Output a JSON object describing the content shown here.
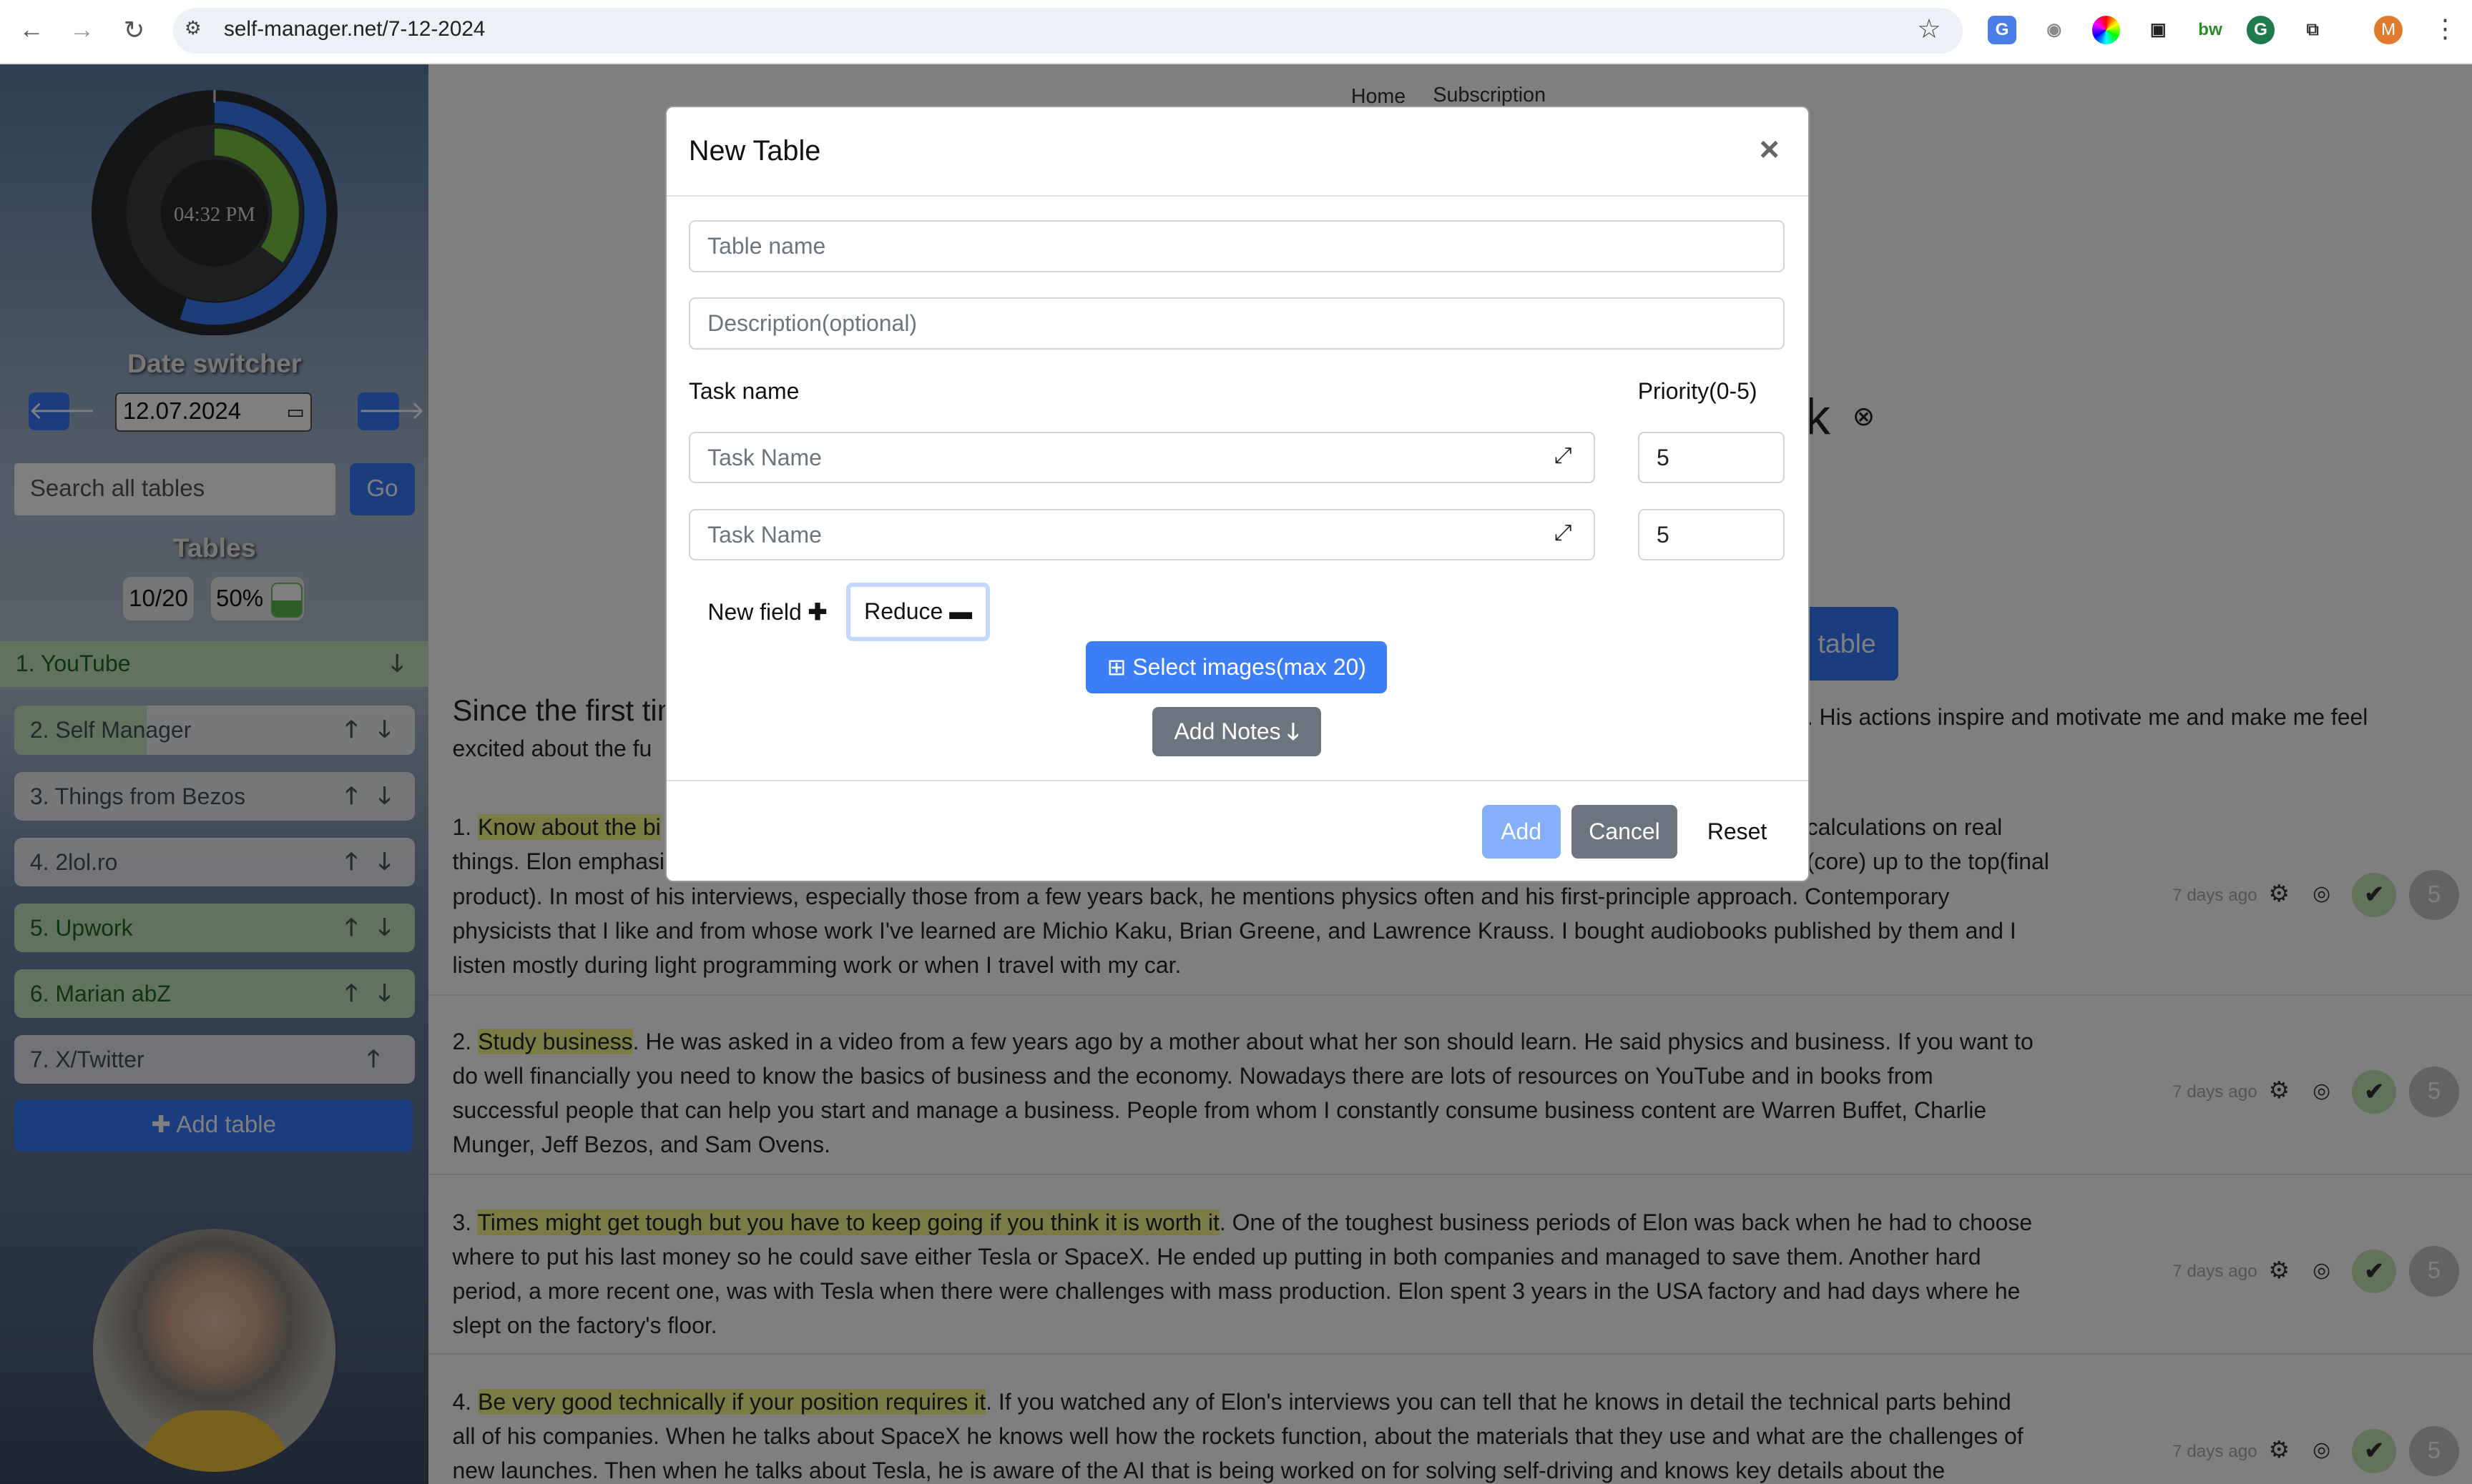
{
  "browser": {
    "url": "self-manager.net/7-12-2024",
    "profile_initial": "M",
    "ext_icons": [
      "translate-icon",
      "camera-icon",
      "color-wheel-icon",
      "extension-icon",
      "bw-icon",
      "grammarly-icon",
      "puzzle-icon"
    ]
  },
  "sidebar": {
    "clock": {
      "time": "04:32 PM",
      "outer_fill": 0.55,
      "inner_fill": 0.35,
      "outer_color": "#3a7bf5",
      "inner_color": "#76c442"
    },
    "date_switcher_label": "Date switcher",
    "date_value": "12.07.2024",
    "search_placeholder": "Search all tables",
    "go_label": "Go",
    "tables_label": "Tables",
    "count_badge": "10/20",
    "percent_badge": "50%",
    "percent_fill": 0.5,
    "tables": [
      {
        "label": "1. YouTube",
        "status": "done"
      },
      {
        "label": "2. Self Manager",
        "status": "partial",
        "progress": 0.33
      },
      {
        "label": "3. Things from Bezos",
        "status": "none"
      },
      {
        "label": "4. 2lol.ro",
        "status": "none"
      },
      {
        "label": "5. Upwork",
        "status": "done"
      },
      {
        "label": "6. Marian abZ",
        "status": "done"
      },
      {
        "label": "7. X/Twitter",
        "status": "none"
      }
    ],
    "add_table_label": "Add table"
  },
  "main": {
    "nav": [
      "Home",
      "Subscription"
    ],
    "title_fragment": "k",
    "table_button_fragment": "table",
    "intro_left": [
      "Since the first time",
      "excited about the fu"
    ],
    "intro_right": ". His actions inspire and motivate me and make me feel",
    "item1": {
      "prefix": "1. ",
      "highlight": "Know about the bi",
      "right_fragments": [
        "calculations on real",
        "(core) up to the top(final"
      ],
      "left_fragment2": "things. Elon emphasi",
      "lines": [
        "product). In most of his interviews, especially those from a few years back, he mentions physics often and his first-principle approach. Contemporary",
        "physicists that I like and from whose work I've learned are Michio Kaku, Brian Greene, and Lawrence Krauss. I bought audiobooks published by them and I",
        "listen mostly during light programming work or when I travel with my car."
      ]
    },
    "items": [
      {
        "prefix": "2. ",
        "highlight": "Study business",
        "rest": ". He was asked in a video from a few years ago by a mother about what her son should learn. He said physics and business. If you want to",
        "lines": [
          "do well financially you need to know the basics of business and the economy. Nowadays there are lots of resources on YouTube and in books from",
          "successful people that can help you start and manage a business. People from whom I constantly consume business content are Warren Buffet, Charlie",
          "Munger, Jeff Bezos, and Sam Ovens."
        ]
      },
      {
        "prefix": "3. ",
        "highlight": "Times might get tough but you have to keep going if you think it is worth it",
        "rest": ". One of the toughest business periods of Elon was back when he had to choose",
        "lines": [
          "where to put his last money so he could save either Tesla or SpaceX. He ended up putting in both companies and managed to save them. Another hard",
          "period, a more recent one, was with Tesla when there were challenges with mass production. Elon spent 3 years in the USA factory and had days where he",
          "slept on the factory's floor."
        ]
      },
      {
        "prefix": "4. ",
        "highlight": "Be very good technically if your position requires it",
        "rest": ". If you watched any of Elon's interviews you can tell that he knows in detail the technical parts behind",
        "lines": [
          "all of his companies. When he talks about SpaceX he knows well how the rockets function, about the materials that they use and what are the challenges of",
          "new launches. Then when he talks about Tesla, he is aware of the AI that is being worked on for solving self-driving and knows key details about the"
        ]
      }
    ],
    "metas": [
      {
        "time": "7 days ago",
        "priority": "5"
      },
      {
        "time": "7 days ago",
        "priority": "5"
      },
      {
        "time": "7 days ago",
        "priority": "5"
      },
      {
        "time": "7 days ago",
        "priority": "5"
      }
    ]
  },
  "modal": {
    "title": "New Table",
    "table_name_placeholder": "Table name",
    "description_placeholder": "Description(optional)",
    "task_name_label": "Task name",
    "priority_label": "Priority(0-5)",
    "tasks": [
      {
        "placeholder": "Task Name",
        "priority": "5"
      },
      {
        "placeholder": "Task Name",
        "priority": "5"
      }
    ],
    "new_field_label": "New field",
    "reduce_label": "Reduce",
    "select_images_label": "Select images(max 20)",
    "add_notes_label": "Add Notes",
    "add_label": "Add",
    "cancel_label": "Cancel",
    "reset_label": "Reset"
  }
}
